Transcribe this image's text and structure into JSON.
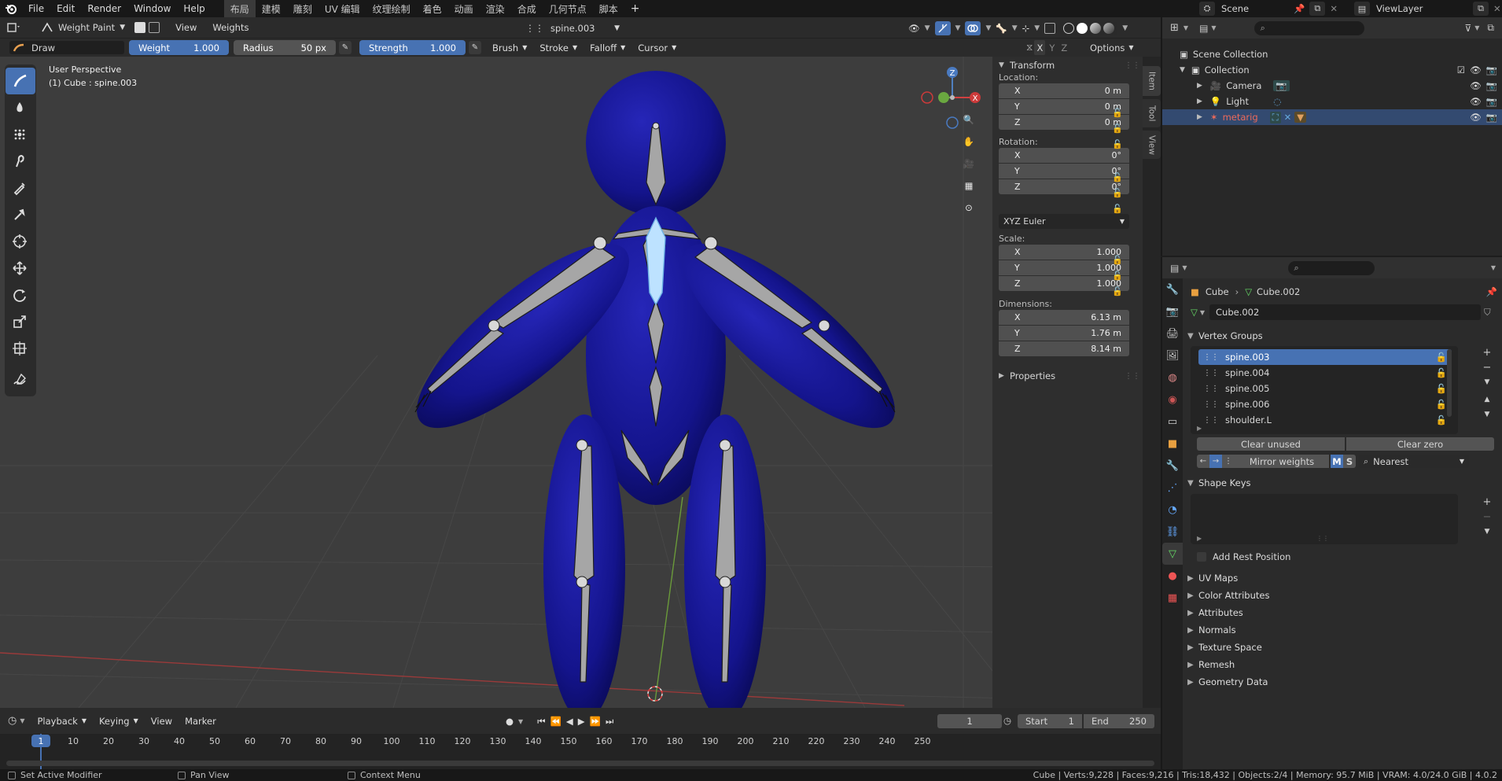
{
  "topmenu": {
    "items": [
      "File",
      "Edit",
      "Render",
      "Window",
      "Help"
    ],
    "workspaces": [
      "布局",
      "建模",
      "雕刻",
      "UV 编辑",
      "纹理绘制",
      "着色",
      "动画",
      "渲染",
      "合成",
      "几何节点",
      "脚本"
    ],
    "active_workspace": "布局",
    "add_tab": "+",
    "scene": "Scene",
    "view_layer": "ViewLayer"
  },
  "viewport_header": {
    "mode": "Weight Paint",
    "view": "View",
    "weights": "Weights",
    "active_group": "spine.003"
  },
  "tool_options": {
    "tool": "Draw",
    "weight_label": "Weight",
    "weight_value": "1.000",
    "radius_label": "Radius",
    "radius_value": "50 px",
    "strength_label": "Strength",
    "strength_value": "1.000",
    "brush": "Brush",
    "stroke": "Stroke",
    "falloff": "Falloff",
    "cursor": "Cursor",
    "axes": [
      "X",
      "Y",
      "Z"
    ],
    "options": "Options"
  },
  "viewport": {
    "perspective": "User Perspective",
    "object_info": "(1) Cube : spine.003"
  },
  "toolbar": {
    "tools": [
      "draw-brush-icon",
      "blur-icon",
      "average-icon",
      "smear-icon",
      "sample-weight-icon",
      "gradient-icon",
      "cursor-icon",
      "move-icon",
      "rotate-icon",
      "scale-icon",
      "transform-icon",
      "annotate-icon"
    ]
  },
  "npanel": {
    "tabs": [
      "Item",
      "Tool",
      "View"
    ],
    "transform": "Transform",
    "location_label": "Location:",
    "location": [
      {
        "axis": "X",
        "value": "0 m"
      },
      {
        "axis": "Y",
        "value": "0 m"
      },
      {
        "axis": "Z",
        "value": "0 m"
      }
    ],
    "rotation_label": "Rotation:",
    "rotation": [
      {
        "axis": "X",
        "value": "0°"
      },
      {
        "axis": "Y",
        "value": "0°"
      },
      {
        "axis": "Z",
        "value": "0°"
      }
    ],
    "rotation_mode": "XYZ Euler",
    "scale_label": "Scale:",
    "scale": [
      {
        "axis": "X",
        "value": "1.000"
      },
      {
        "axis": "Y",
        "value": "1.000"
      },
      {
        "axis": "Z",
        "value": "1.000"
      }
    ],
    "dimensions_label": "Dimensions:",
    "dimensions": [
      {
        "axis": "X",
        "value": "6.13 m"
      },
      {
        "axis": "Y",
        "value": "1.76 m"
      },
      {
        "axis": "Z",
        "value": "8.14 m"
      }
    ],
    "properties": "Properties"
  },
  "outliner": {
    "scene_collection": "Scene Collection",
    "collection": "Collection",
    "objects": [
      {
        "name": "Camera",
        "color": "#e0a060"
      },
      {
        "name": "Light",
        "color": "#e0a060"
      },
      {
        "name": "metarig",
        "color": "#ee6a5a"
      }
    ]
  },
  "properties": {
    "breadcrumb_object": "Cube",
    "breadcrumb_data": "Cube.002",
    "data_name": "Cube.002",
    "vertex_groups_title": "Vertex Groups",
    "vertex_groups": [
      "spine.003",
      "spine.004",
      "spine.005",
      "spine.006",
      "shoulder.L"
    ],
    "clear_unused": "Clear unused",
    "clear_zero": "Clear zero",
    "mirror_weights": "Mirror weights",
    "mirror_m": "M",
    "mirror_s": "S",
    "nearest": "Nearest",
    "shape_keys_title": "Shape Keys",
    "add_rest_position": "Add Rest Position",
    "sections": [
      "UV Maps",
      "Color Attributes",
      "Attributes",
      "Normals",
      "Texture Space",
      "Remesh",
      "Geometry Data"
    ]
  },
  "timeline": {
    "playback": "Playback",
    "keying": "Keying",
    "view": "View",
    "marker": "Marker",
    "current_frame": "1",
    "start_label": "Start",
    "start": "1",
    "end_label": "End",
    "end": "250",
    "ruler": [
      "1",
      "10",
      "20",
      "30",
      "40",
      "50",
      "60",
      "70",
      "80",
      "90",
      "100",
      "110",
      "120",
      "130",
      "140",
      "150",
      "160",
      "170",
      "180",
      "190",
      "200",
      "210",
      "220",
      "230",
      "240",
      "250"
    ]
  },
  "status": {
    "left": "Set Active Modifier",
    "middle": "Pan View",
    "right": "Context Menu",
    "stats": "Cube | Verts:9,228 | Faces:9,216 | Tris:18,432 | Objects:2/4 | Memory: 95.7 MiB | VRAM: 4.0/24.0 GiB | 4.0.2"
  },
  "colors": {
    "accent": "#4772b3",
    "mesh": "#1a1a96",
    "bone": "#a6a6a6",
    "selected_row": "#3d5e96"
  }
}
